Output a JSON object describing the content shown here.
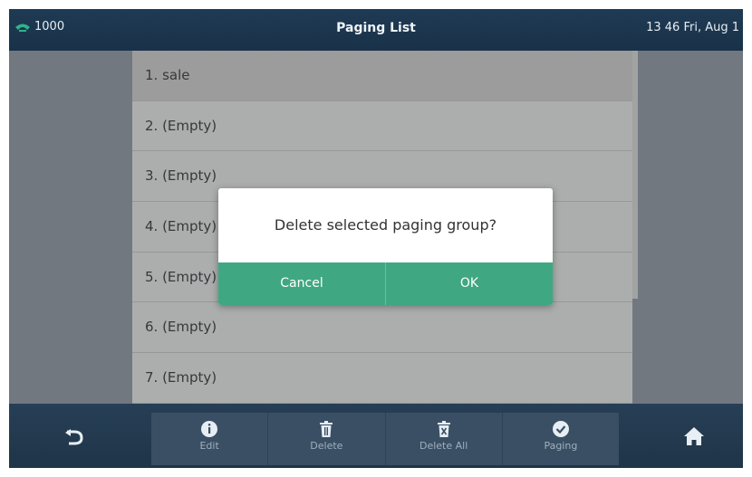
{
  "status": {
    "account": "1000",
    "title": "Paging List",
    "datetime": "13 46 Fri, Aug 1"
  },
  "paging_list": {
    "items": [
      {
        "label": "1. sale"
      },
      {
        "label": "2. (Empty)"
      },
      {
        "label": "3. (Empty)"
      },
      {
        "label": "4. (Empty)"
      },
      {
        "label": "5. (Empty)"
      },
      {
        "label": "6. (Empty)"
      },
      {
        "label": "7. (Empty)"
      }
    ]
  },
  "dialog": {
    "message": "Delete selected paging group?",
    "cancel_label": "Cancel",
    "ok_label": "OK"
  },
  "softkeys": [
    {
      "label": "Edit",
      "icon": "info-icon"
    },
    {
      "label": "Delete",
      "icon": "trash-icon"
    },
    {
      "label": "Delete All",
      "icon": "trash-x-icon"
    },
    {
      "label": "Paging",
      "icon": "check-circle-icon"
    }
  ],
  "nav": {
    "back_icon": "back-arrow-icon",
    "home_icon": "home-icon"
  },
  "colors": {
    "accent": "#3fa882",
    "header": "#1f3a54"
  }
}
